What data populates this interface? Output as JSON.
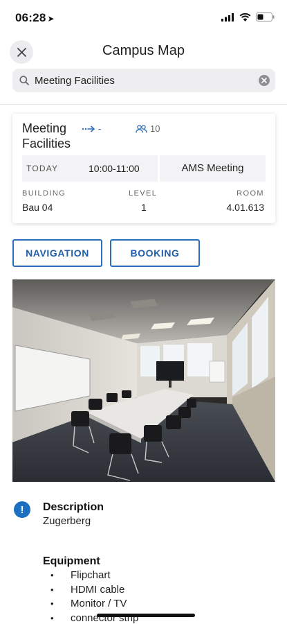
{
  "status_bar": {
    "time": "06:28"
  },
  "nav": {
    "title": "Campus Map"
  },
  "search": {
    "value": "Meeting Facilities"
  },
  "card": {
    "title": "Meeting Facilities",
    "nav_meta": "-",
    "capacity": "10",
    "booking": {
      "day_label": "TODAY",
      "time": "10:00-11:00",
      "name": "AMS Meeting"
    },
    "location": {
      "building_label": "BUILDING",
      "building": "Bau 04",
      "level_label": "LEVEL",
      "level": "1",
      "room_label": "ROOM",
      "room": "4.01.613"
    }
  },
  "actions": {
    "navigation": "NAVIGATION",
    "booking": "BOOKING"
  },
  "description": {
    "heading": "Description",
    "text": "Zugerberg"
  },
  "equipment": {
    "heading": "Equipment",
    "items": [
      "Flipchart",
      "HDMI cable",
      "Monitor / TV",
      "connector strip"
    ]
  },
  "colors": {
    "accent": "#2a6ebb",
    "info": "#1d6fc2"
  }
}
